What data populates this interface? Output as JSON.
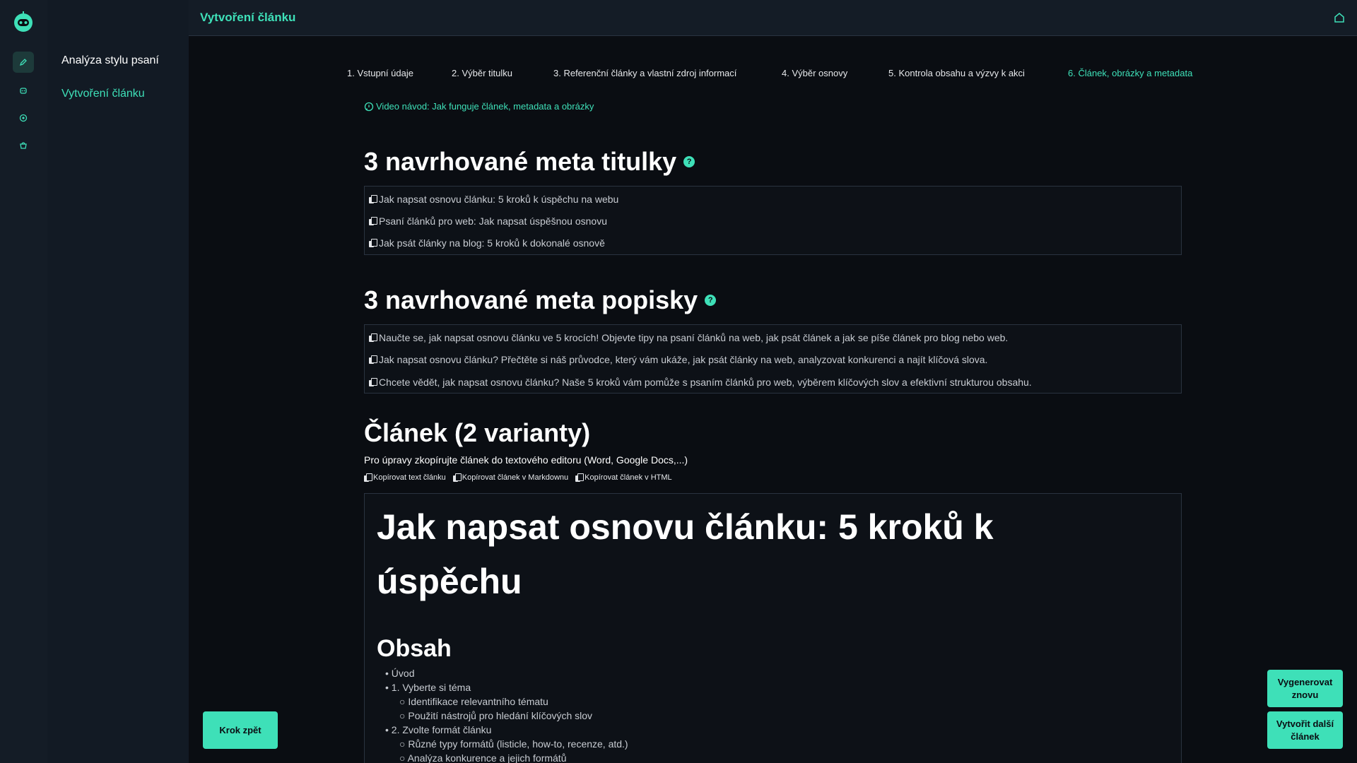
{
  "app": {
    "title": "Vytvoření článku"
  },
  "colors": {
    "accent": "#3ee0b8",
    "background": "#0a0d12",
    "panel": "#141c26"
  },
  "rail": {
    "icons": [
      "pencil-icon",
      "robot-icon",
      "target-icon",
      "pie-icon"
    ]
  },
  "sidebar": {
    "items": [
      {
        "label": "Analýza stylu psaní"
      },
      {
        "label": "Vytvoření článku"
      }
    ]
  },
  "steps": [
    {
      "label": "1. Vstupní údaje"
    },
    {
      "label": "2. Výběr titulku"
    },
    {
      "label": "3. Referenční články a vlastní zdroj informací"
    },
    {
      "label": "4. Výběr osnovy"
    },
    {
      "label": "5. Kontrola obsahu a výzvy k akci"
    },
    {
      "label": "6. Článek, obrázky a metadata"
    }
  ],
  "video_link": "Video návod: Jak funguje článek, metadata a obrázky",
  "meta_titles": {
    "heading": "3 navrhované meta titulky",
    "help": "?",
    "items": [
      "Jak napsat osnovu článku: 5 kroků k úspěchu na webu",
      "Psaní článků pro web: Jak napsat úspěšnou osnovu",
      "Jak psát články na blog: 5 kroků k dokonalé osnově"
    ]
  },
  "meta_descriptions": {
    "heading": "3 navrhované meta popisky",
    "help": "?",
    "items": [
      "Naučte se, jak napsat osnovu článku ve 5 krocích! Objevte tipy na psaní článků na web, jak psát článek a jak se píše článek pro blog nebo web.",
      "Jak napsat osnovu článku? Přečtěte si náš průvodce, který vám ukáže, jak psát články na web, analyzovat konkurenci a najít klíčová slova.",
      "Chcete vědět, jak napsat osnovu článku? Naše 5 kroků vám pomůže s psaním článků pro web, výběrem klíčových slov a efektivní strukturou obsahu."
    ]
  },
  "article": {
    "heading": "Článek (2 varianty)",
    "note": "Pro úpravy zkopírujte článek do textového editoru (Word, Google Docs,...)",
    "copy_buttons": [
      "Kopírovat text článku",
      "Kopírovat článek v Markdownu",
      "Kopírovat článek v HTML"
    ],
    "h1": "Jak napsat osnovu článku: 5 kroků k úspěchu",
    "toc_title": "Obsah",
    "toc": [
      {
        "text": "Úvod",
        "level": 1
      },
      {
        "text": "1. Vyberte si téma",
        "level": 1
      },
      {
        "text": "Identifikace relevantního tématu",
        "level": 2
      },
      {
        "text": "Použití nástrojů pro hledání klíčových slov",
        "level": 2
      },
      {
        "text": "2. Zvolte formát článku",
        "level": 1
      },
      {
        "text": "Různé typy formátů (listicle, how-to, recenze, atd.)",
        "level": 2
      },
      {
        "text": "Analýza konkurence a jejich formátů",
        "level": 2
      }
    ]
  },
  "buttons": {
    "back": "Krok zpět",
    "regenerate": "Vygenerovat znovu",
    "next_article": "Vytvořit další článek"
  }
}
